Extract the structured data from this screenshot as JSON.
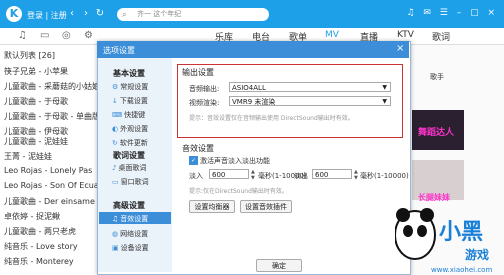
{
  "topbar": {
    "logo": "K",
    "login": "登录 | 注册",
    "search_placeholder": "齐一 这个年纪"
  },
  "tabs": [
    {
      "label": "乐库"
    },
    {
      "label": "电台"
    },
    {
      "label": "歌单"
    },
    {
      "label": "MV",
      "active": true
    },
    {
      "label": "直播"
    },
    {
      "label": "KTV"
    },
    {
      "label": "歌词"
    }
  ],
  "sidebar": {
    "list_title": "默认列表 [26]",
    "songs": [
      "筷子兄弟 - 小苹果",
      "儿童歌曲 - 采蘑菇的小姑娘",
      "儿童歌曲 - 于母歌",
      "儿童歌曲 - 于母歌 - 单曲版",
      "儿童歌曲 - 伊母歌",
      "儿童歌曲 - 泥娃娃",
      "王菁 - 泥娃娃",
      "Leo Rojas - Lonely Pas",
      "Leo Rojas - Son Of Ecuad..",
      "儿童歌曲 - Der einsame ...",
      "卓依婷 - 捉泥鳅",
      "儿童歌曲 - 两只老虎",
      "纯音乐 - Love story",
      "纯音乐 - Monterey"
    ]
  },
  "rightarea": {
    "header_tab": "歌手",
    "thumb1_caption": "舞蹈达人",
    "thumb2_caption": "长腿妹妹"
  },
  "dialog": {
    "title": "选项设置",
    "close": "×",
    "nav": {
      "section_basic": "基本设置",
      "items_basic": [
        {
          "label": "常规设置",
          "icon": "gear-icon"
        },
        {
          "label": "下载设置",
          "icon": "download-icon"
        },
        {
          "label": "快捷键",
          "icon": "keyboard-icon"
        },
        {
          "label": "外观设置",
          "icon": "skin-icon"
        },
        {
          "label": "软件更新",
          "icon": "update-icon"
        }
      ],
      "section_lyrics": "歌词设置",
      "items_lyrics": [
        {
          "label": "桌面歌词",
          "icon": "lyrics-icon"
        },
        {
          "label": "窗口歌词",
          "icon": "window-icon"
        }
      ],
      "section_advanced": "高级设置",
      "items_advanced": [
        {
          "label": "音效设置",
          "icon": "sound-icon",
          "active": true
        },
        {
          "label": "网络设置",
          "icon": "network-icon"
        },
        {
          "label": "设备设置",
          "icon": "device-icon"
        }
      ]
    },
    "output": {
      "title": "输出设置",
      "audio_label": "音频输出:",
      "audio_value": "ASIO4ALL",
      "video_label": "视频渲染:",
      "video_value": "VMR9 未渲染",
      "hint": "提示：音效设置仅在音频输出使用 DirectSound输出时有效。"
    },
    "effects": {
      "title": "音效设置",
      "fade_checkbox": "激活声音淡入淡出功能",
      "fadein_label": "淡入",
      "fadein_value": "600",
      "fadein_unit": "毫秒(1-10000)",
      "fadeout_label": "淡出",
      "fadeout_value": "600",
      "fadeout_unit": "毫秒(1-10000)",
      "hint": "提示:仅在DirectSound输出时有效。",
      "eq_button": "设置均衡器",
      "plugin_button": "设置音效插件"
    },
    "ok_button": "确定"
  },
  "watermark": {
    "brand": "小黑游戏",
    "url": "www.xiaohei.com"
  },
  "colors": {
    "accent": "#1ea0e8",
    "dialog_title": "#3d8ed8",
    "highlight_box": "#cc3333"
  }
}
